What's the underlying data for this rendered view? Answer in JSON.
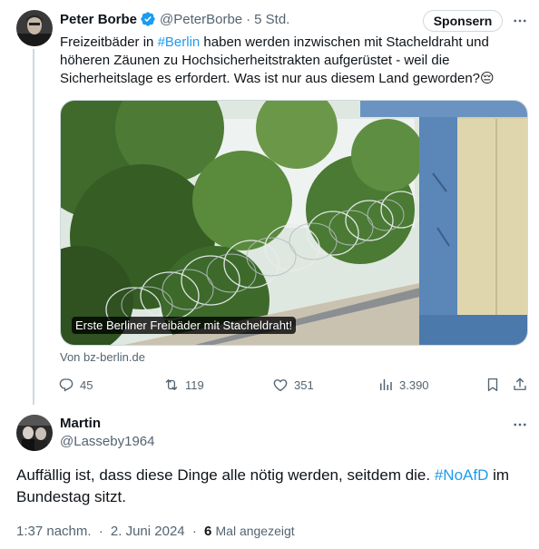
{
  "tweet": {
    "author_name": "Peter Borbe",
    "handle": "@PeterBorbe",
    "separator": "·",
    "time": "5 Std.",
    "sponsor_label": "Sponsern",
    "text_before": "Freizeitbäder in ",
    "hashtag": "#Berlin",
    "text_after": " haben werden inzwischen mit Stacheldraht und höheren Zäunen zu Hochsicherheitstrakten aufgerüstet - weil die Sicherheitslage es erfordert. Was ist nur aus diesem Land geworden?",
    "emoji": "😔",
    "media_caption": "Erste Berliner Freibäder mit Stacheldraht!",
    "source": "Von bz-berlin.de",
    "actions": {
      "replies": "45",
      "reposts": "119",
      "likes": "351",
      "views": "3.390"
    }
  },
  "reply": {
    "author_name": "Martin",
    "handle": "@Lasseby1964",
    "text_before": "Auffällig ist, dass diese Dinge alle nötig werden, seitdem die. ",
    "hashtag": "#NoAfD",
    "text_after": " im Bundestag sitzt.",
    "time": "1:37 nachm.",
    "separator": "·",
    "date": "2. Juni 2024",
    "view_count": "6",
    "view_label": "Mal angezeigt"
  },
  "colors": {
    "accent": "#1d9bf0",
    "secondary_text": "#536471",
    "border": "#cfd9de"
  },
  "icons": [
    "verified-badge-icon",
    "more-icon",
    "reply-icon",
    "repost-icon",
    "like-icon",
    "views-icon",
    "bookmark-icon",
    "share-icon"
  ]
}
